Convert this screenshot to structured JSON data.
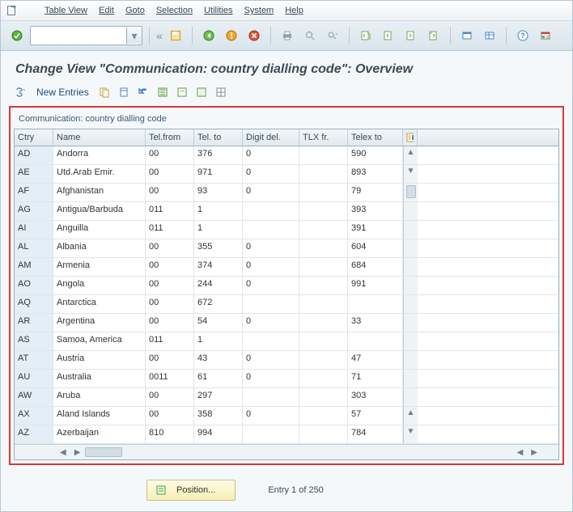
{
  "menu": {
    "items": [
      "Table View",
      "Edit",
      "Goto",
      "Selection",
      "Utilities",
      "System",
      "Help"
    ]
  },
  "title": "Change View \"Communication: country dialling code\": Overview",
  "subtoolbar": {
    "new_entries": "New Entries"
  },
  "panel": {
    "title": "Communication: country dialling code",
    "columns": [
      "Ctry",
      "Name",
      "Tel.from",
      "Tel. to",
      "Digit del.",
      "TLX fr.",
      "Telex to"
    ],
    "rows": [
      {
        "ctry": "AD",
        "name": "Andorra",
        "tel_from": "00",
        "tel_to": "376",
        "digit_del": "0",
        "tlx_fr": "",
        "telex_to": "590"
      },
      {
        "ctry": "AE",
        "name": "Utd.Arab Emir.",
        "tel_from": "00",
        "tel_to": "971",
        "digit_del": "0",
        "tlx_fr": "",
        "telex_to": "893"
      },
      {
        "ctry": "AF",
        "name": "Afghanistan",
        "tel_from": "00",
        "tel_to": "93",
        "digit_del": "0",
        "tlx_fr": "",
        "telex_to": "79"
      },
      {
        "ctry": "AG",
        "name": "Antigua/Barbuda",
        "tel_from": "011",
        "tel_to": "1",
        "digit_del": "",
        "tlx_fr": "",
        "telex_to": "393"
      },
      {
        "ctry": "AI",
        "name": "Anguilla",
        "tel_from": "011",
        "tel_to": "1",
        "digit_del": "",
        "tlx_fr": "",
        "telex_to": "391"
      },
      {
        "ctry": "AL",
        "name": "Albania",
        "tel_from": "00",
        "tel_to": "355",
        "digit_del": "0",
        "tlx_fr": "",
        "telex_to": "604"
      },
      {
        "ctry": "AM",
        "name": "Armenia",
        "tel_from": "00",
        "tel_to": "374",
        "digit_del": "0",
        "tlx_fr": "",
        "telex_to": "684"
      },
      {
        "ctry": "AO",
        "name": "Angola",
        "tel_from": "00",
        "tel_to": "244",
        "digit_del": "0",
        "tlx_fr": "",
        "telex_to": "991"
      },
      {
        "ctry": "AQ",
        "name": "Antarctica",
        "tel_from": "00",
        "tel_to": "672",
        "digit_del": "",
        "tlx_fr": "",
        "telex_to": ""
      },
      {
        "ctry": "AR",
        "name": "Argentina",
        "tel_from": "00",
        "tel_to": "54",
        "digit_del": "0",
        "tlx_fr": "",
        "telex_to": "33"
      },
      {
        "ctry": "AS",
        "name": "Samoa, America",
        "tel_from": "011",
        "tel_to": "1",
        "digit_del": "",
        "tlx_fr": "",
        "telex_to": ""
      },
      {
        "ctry": "AT",
        "name": "Austria",
        "tel_from": "00",
        "tel_to": "43",
        "digit_del": "0",
        "tlx_fr": "",
        "telex_to": "47"
      },
      {
        "ctry": "AU",
        "name": "Australia",
        "tel_from": "0011",
        "tel_to": "61",
        "digit_del": "0",
        "tlx_fr": "",
        "telex_to": "71"
      },
      {
        "ctry": "AW",
        "name": "Aruba",
        "tel_from": "00",
        "tel_to": "297",
        "digit_del": "",
        "tlx_fr": "",
        "telex_to": "303"
      },
      {
        "ctry": "AX",
        "name": "Aland Islands",
        "tel_from": "00",
        "tel_to": "358",
        "digit_del": "0",
        "tlx_fr": "",
        "telex_to": "57"
      },
      {
        "ctry": "AZ",
        "name": "Azerbaijan",
        "tel_from": "810",
        "tel_to": "994",
        "digit_del": "",
        "tlx_fr": "",
        "telex_to": "784"
      }
    ]
  },
  "footer": {
    "position_label": "Position...",
    "status": "Entry 1 of 250"
  },
  "icons": {
    "grip": "grip-icon"
  }
}
